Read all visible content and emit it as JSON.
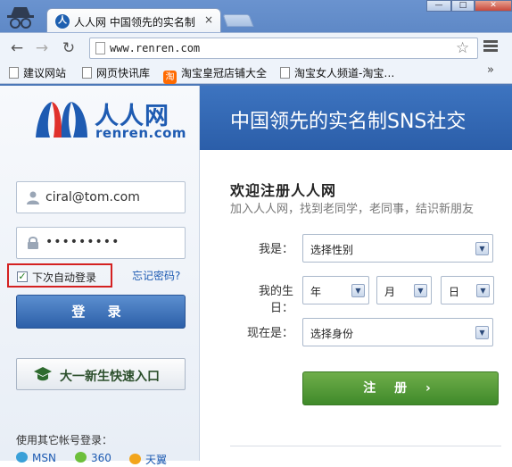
{
  "browser": {
    "tab_title": "人人网 中国领先的实名制",
    "tab_close": "×",
    "favicon_glyph": "人",
    "url": "www.renren.com",
    "window_buttons": [
      "—",
      "□",
      "✕"
    ],
    "bookmarks": [
      "建议网站",
      "网页快讯库",
      "淘宝皇冠店铺大全",
      "淘宝女人频道-淘宝…"
    ],
    "taobao_glyph": "淘",
    "bookmarks_more": "»",
    "nav": {
      "back": "←",
      "forward": "→",
      "reload": "↻",
      "star": "☆"
    }
  },
  "logo": {
    "cn": "人人网",
    "en": "renren.com"
  },
  "login": {
    "email": "ciral@tom.com",
    "password_mask": "•••••••••",
    "remember_label": "下次自动登录",
    "remember_checked": "✓",
    "forgot_label": "忘记密码?",
    "login_button": "登 录",
    "freshman_button": "大一新生快速入口",
    "other_accounts_label": "使用其它帐号登录：",
    "oauth": [
      "MSN",
      "360",
      "天翼"
    ]
  },
  "banner": {
    "text": "中国领先的实名制SNS社交"
  },
  "register": {
    "welcome": "欢迎注册人人网",
    "subtitle": "加入人人网，找到老同学，老同事，结识新朋友",
    "gender_label": "我是：",
    "gender_value": "选择性别",
    "birthday_label": "我的生日：",
    "year_value": "年",
    "month_value": "月",
    "day_value": "日",
    "status_label": "现在是：",
    "status_value": "选择身份",
    "submit_label": "注 册 ›"
  },
  "colors": {
    "brand_blue": "#1e5bb2",
    "banner_blue": "#2b5ea9",
    "register_green": "#3f8a2a",
    "highlight_red": "#d42121"
  }
}
